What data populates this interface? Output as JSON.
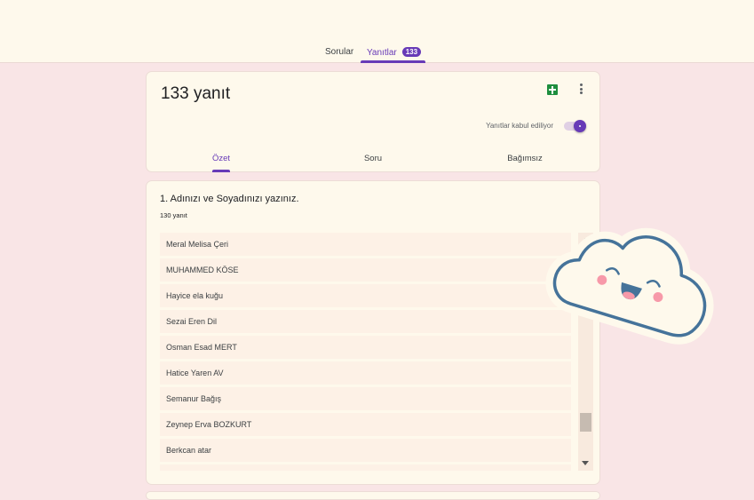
{
  "header": {
    "tabs": [
      {
        "label": "Sorular"
      },
      {
        "label": "Yanıtlar",
        "badge": "133",
        "active": true
      }
    ]
  },
  "summary": {
    "title": "133 yanıt",
    "accepting_label": "Yanıtlar kabul ediliyor",
    "accepting": true,
    "tabs": [
      {
        "label": "Özet",
        "active": true
      },
      {
        "label": "Soru"
      },
      {
        "label": "Bağımsız"
      }
    ]
  },
  "question": {
    "title": "1. Adınızı ve Soyadınızı yazınız.",
    "count": "130 yanıt",
    "answers": [
      "Meral Melisa Çeri",
      "MUHAMMED KÖSE",
      "Hayice ela kuğu",
      "Sezai Eren Dil",
      "Osman Esad MERT",
      "Hatice Yaren AV",
      "Semanur Bağış",
      "Zeynep Erva BOZKURT",
      "Berkcan atar",
      ""
    ]
  },
  "colors": {
    "accent": "#673ab7",
    "background": "#f9e5e6",
    "card": "#fef9ec",
    "sheets": "#1e8e3e"
  },
  "icons": {
    "sheets": "sheets-icon",
    "more": "more-vert-icon",
    "sticker": "cloud-sticker"
  }
}
